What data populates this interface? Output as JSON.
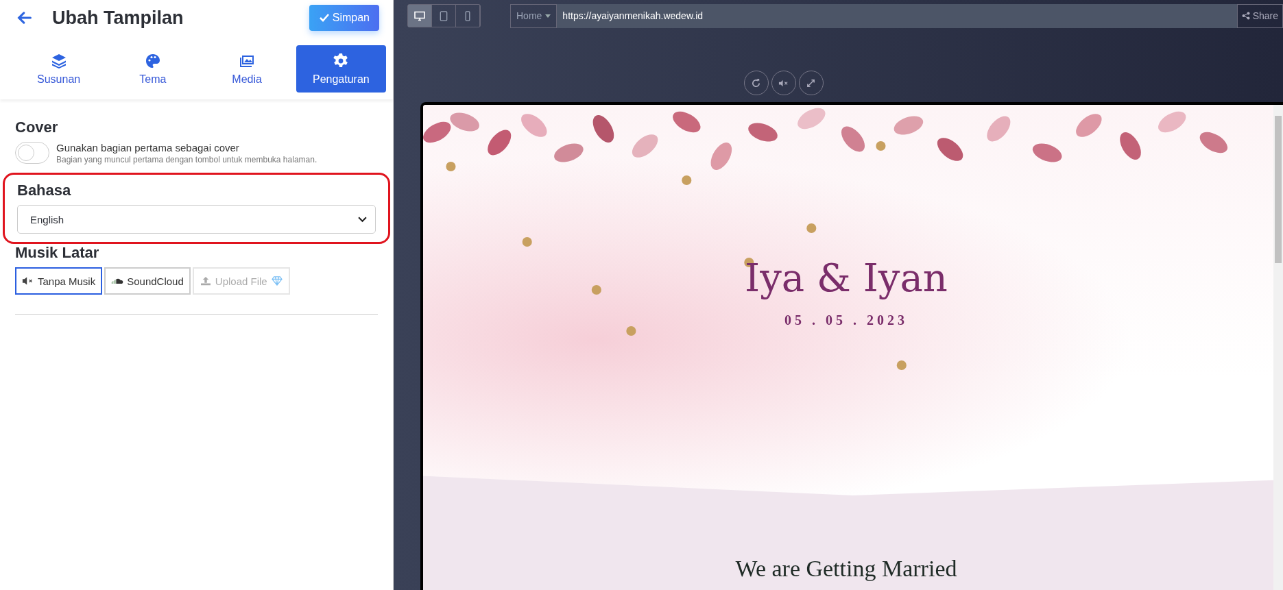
{
  "header": {
    "title": "Ubah Tampilan",
    "save_button": "Simpan"
  },
  "tabs": [
    {
      "label": "Susunan",
      "selected": false
    },
    {
      "label": "Tema",
      "selected": false
    },
    {
      "label": "Media",
      "selected": false
    },
    {
      "label": "Pengaturan",
      "selected": true
    }
  ],
  "cover": {
    "heading": "Cover",
    "toggle": {
      "on": false,
      "label": "Gunakan bagian pertama sebagai cover",
      "hint": "Bagian yang muncul pertama dengan tombol untuk membuka halaman."
    }
  },
  "language": {
    "heading": "Bahasa",
    "highlighted": true,
    "value": "English"
  },
  "music": {
    "heading": "Musik Latar",
    "options": [
      {
        "label": "Tanpa Musik",
        "selected": true,
        "disabled": false
      },
      {
        "label": "SoundCloud",
        "selected": false,
        "disabled": false
      },
      {
        "label": "Upload File",
        "selected": false,
        "disabled": true
      }
    ]
  },
  "preview_toolbar": {
    "devices": [
      {
        "selected": true
      },
      {
        "selected": false
      },
      {
        "selected": false
      }
    ],
    "page_dropdown": "Home",
    "url": "https://ayaiyanmenikah.wedew.id",
    "share_button": "Share"
  },
  "invitation": {
    "names": "Iya & Iyan",
    "date": "05 . 05 . 2023",
    "section_title": "We are Getting Married"
  }
}
